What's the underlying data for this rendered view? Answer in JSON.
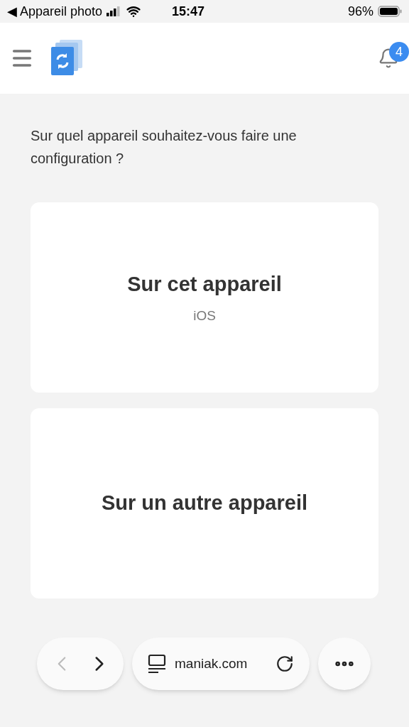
{
  "status_bar": {
    "back_app": "◀ Appareil photo",
    "time": "15:47",
    "battery": "96%"
  },
  "header": {
    "notifications_badge": "4"
  },
  "question": "Sur quel appareil souhaitez-vous faire une configuration ?",
  "options": [
    {
      "title": "Sur cet appareil",
      "subtitle": "iOS"
    },
    {
      "title": "Sur un autre appareil"
    }
  ],
  "browser_bar": {
    "back_disabled": true,
    "forward_disabled": false,
    "url": "maniak.com"
  }
}
